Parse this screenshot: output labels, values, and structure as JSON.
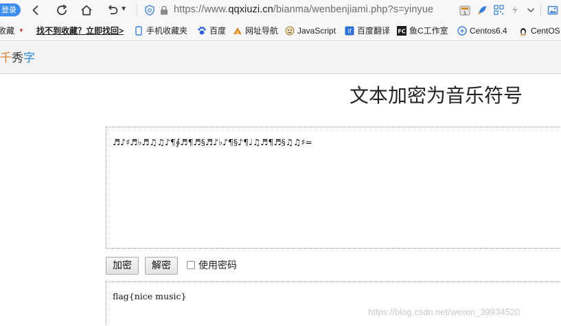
{
  "browser": {
    "login_label": "登录",
    "url_prefix": "https://www.",
    "url_host": "qqxiuzi.cn",
    "url_path": "/bianma/wenbenjiami.php?s=yinyue",
    "icons": [
      "back-icon",
      "refresh-icon",
      "home-icon",
      "undo-icon",
      "shield-icon",
      "lock-icon",
      "extension-badge-icon",
      "rocket-icon",
      "qr-code-icon",
      "lightning-icon",
      "chevron-down-icon",
      "picture-icon"
    ]
  },
  "bookmarks": {
    "items": [
      {
        "label": "收藏",
        "icon": "star-icon"
      },
      {
        "label": "找不到收藏？立即找回>",
        "icon": ""
      },
      {
        "label": "手机收藏夹",
        "icon": "mobile-icon"
      },
      {
        "label": "百度",
        "icon": "baidu-paw-icon"
      },
      {
        "label": "网址导航",
        "icon": "navigation-icon"
      },
      {
        "label": "JavaScript",
        "icon": "javascript-icon"
      },
      {
        "label": "百度翻译",
        "icon": "translate-icon"
      },
      {
        "label": "鱼C工作室",
        "icon": "fishc-icon"
      },
      {
        "label": "Centos6.4",
        "icon": "centos-icon"
      },
      {
        "label": "CentOS",
        "icon": "linux-icon"
      }
    ]
  },
  "site": {
    "logo_char1": "千",
    "logo_char2": "秀",
    "logo_char3": "字"
  },
  "main": {
    "title": "文本加密为音乐符号",
    "input_text": "♬♪♯♬♭♬♫♫♪¶∮♬¶♬§♬♪♭♪¶§♪¶♩♫♬¶♬§♫♫♯=",
    "encrypt_label": "加密",
    "decrypt_label": "解密",
    "use_password_label": "使用密码",
    "output_text": "flag{nice music}"
  },
  "watermark": "https://blog.csdn.net/weixin_39934520"
}
